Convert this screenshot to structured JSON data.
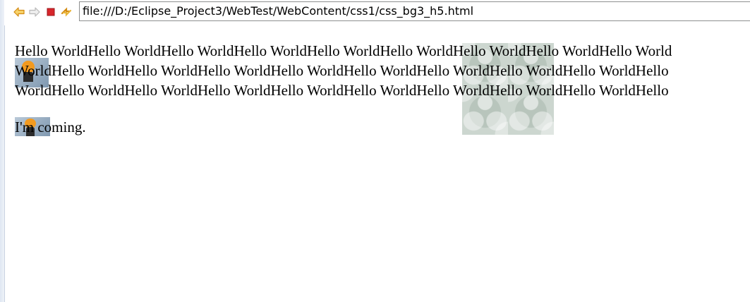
{
  "toolbar": {
    "back_icon": "back-arrow-icon",
    "forward_icon": "forward-arrow-icon",
    "stop_icon": "stop-icon",
    "refresh_icon": "refresh-icon",
    "url": "file:///D:/Eclipse_Project3/WebTest/WebContent/css1/css_bg3_h5.html"
  },
  "content": {
    "hello_lines": [
      "Hello WorldHello WorldHello WorldHello WorldHello WorldHello WorldHello WorldHello WorldHello World",
      "WorldHello WorldHello WorldHello WorldHello WorldHello WorldHello WorldHello WorldHello WorldHello",
      "WorldHello WorldHello WorldHello WorldHello WorldHello WorldHello WorldHello WorldHello WorldHello"
    ],
    "coming_text": "I'm coming."
  },
  "colors": {
    "accent_back": "#f2a51c",
    "stop": "#d7262b",
    "damask_bg": "#ccd6cf"
  }
}
